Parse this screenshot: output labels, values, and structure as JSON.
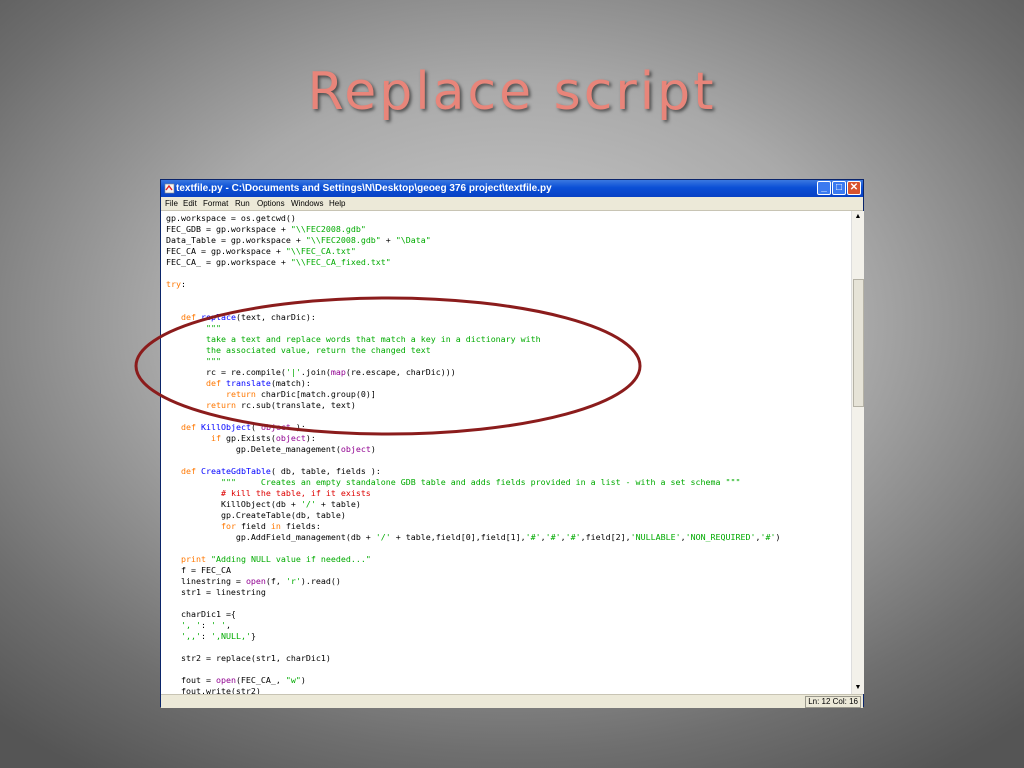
{
  "slide": {
    "title": "Replace script"
  },
  "window": {
    "title": "textfile.py - C:\\Documents and Settings\\N\\Desktop\\geoeg 376 project\\textfile.py",
    "controls": {
      "minimize": "_",
      "maximize": "□",
      "close": "✕"
    }
  },
  "menu": [
    "File",
    "Edit",
    "Format",
    "Run",
    "Options",
    "Windows",
    "Help"
  ],
  "code_lines": [
    [
      [
        "n",
        "gp.workspace = os.getcwd()"
      ]
    ],
    [
      [
        "n",
        "FEC_GDB = gp.workspace + "
      ],
      [
        "s",
        "\"\\\\FEC2008.gdb\""
      ]
    ],
    [
      [
        "n",
        "Data_Table = gp.workspace + "
      ],
      [
        "s",
        "\"\\\\FEC2008.gdb\""
      ],
      [
        "n",
        " + "
      ],
      [
        "s",
        "\"\\Data\""
      ]
    ],
    [
      [
        "n",
        "FEC_CA = gp.workspace + "
      ],
      [
        "s",
        "\"\\\\FEC_CA.txt\""
      ]
    ],
    [
      [
        "n",
        "FEC_CA_ = gp.workspace + "
      ],
      [
        "s",
        "\"\\\\FEC_CA_fixed.txt\""
      ]
    ],
    [
      [
        "n",
        ""
      ]
    ],
    [
      [
        "k",
        "try"
      ],
      [
        "n",
        ":"
      ]
    ],
    [
      [
        "n",
        ""
      ]
    ],
    [
      [
        "n",
        ""
      ]
    ],
    [
      [
        "n",
        "   "
      ],
      [
        "k",
        "def"
      ],
      [
        "n",
        " "
      ],
      [
        "f",
        "replace"
      ],
      [
        "n",
        "(text, charDic):"
      ]
    ],
    [
      [
        "n",
        "        "
      ],
      [
        "s",
        "\"\"\""
      ]
    ],
    [
      [
        "n",
        "        "
      ],
      [
        "s",
        "take a text and replace words that match a key in a dictionary with"
      ]
    ],
    [
      [
        "n",
        "        "
      ],
      [
        "s",
        "the associated value, return the changed text"
      ]
    ],
    [
      [
        "n",
        "        "
      ],
      [
        "s",
        "\"\"\""
      ]
    ],
    [
      [
        "n",
        "        rc = re.compile("
      ],
      [
        "s",
        "'|'"
      ],
      [
        "n",
        ".join("
      ],
      [
        "b",
        "map"
      ],
      [
        "n",
        "(re.escape, charDic)))"
      ]
    ],
    [
      [
        "n",
        "        "
      ],
      [
        "k",
        "def"
      ],
      [
        "n",
        " "
      ],
      [
        "f",
        "translate"
      ],
      [
        "n",
        "(match):"
      ]
    ],
    [
      [
        "n",
        "            "
      ],
      [
        "k",
        "return"
      ],
      [
        "n",
        " charDic[match.group(0)]"
      ]
    ],
    [
      [
        "n",
        "        "
      ],
      [
        "k",
        "return"
      ],
      [
        "n",
        " rc.sub(translate, text)"
      ]
    ],
    [
      [
        "n",
        ""
      ]
    ],
    [
      [
        "n",
        "   "
      ],
      [
        "k",
        "def"
      ],
      [
        "n",
        " "
      ],
      [
        "f",
        "KillObject"
      ],
      [
        "n",
        "( "
      ],
      [
        "b",
        "object"
      ],
      [
        "n",
        " ):"
      ]
    ],
    [
      [
        "n",
        "         "
      ],
      [
        "k",
        "if"
      ],
      [
        "n",
        " gp.Exists("
      ],
      [
        "b",
        "object"
      ],
      [
        "n",
        "):"
      ]
    ],
    [
      [
        "n",
        "              gp.Delete_management("
      ],
      [
        "b",
        "object"
      ],
      [
        "n",
        ")"
      ]
    ],
    [
      [
        "n",
        ""
      ]
    ],
    [
      [
        "n",
        "   "
      ],
      [
        "k",
        "def"
      ],
      [
        "n",
        " "
      ],
      [
        "f",
        "CreateGdbTable"
      ],
      [
        "n",
        "( db, table, fields ):"
      ]
    ],
    [
      [
        "n",
        "           "
      ],
      [
        "s",
        "\"\"\"     Creates an empty standalone GDB table and adds fields provided in a list - with a set schema \"\"\""
      ]
    ],
    [
      [
        "n",
        "           "
      ],
      [
        "c",
        "# kill the table, if it exists"
      ]
    ],
    [
      [
        "n",
        "           KillObject(db + "
      ],
      [
        "s",
        "'/'"
      ],
      [
        "n",
        " + table)"
      ]
    ],
    [
      [
        "n",
        "           gp.CreateTable(db, table)"
      ]
    ],
    [
      [
        "n",
        "           "
      ],
      [
        "k",
        "for"
      ],
      [
        "n",
        " field "
      ],
      [
        "k",
        "in"
      ],
      [
        "n",
        " fields:"
      ]
    ],
    [
      [
        "n",
        "              gp.AddField_management(db + "
      ],
      [
        "s",
        "'/'"
      ],
      [
        "n",
        " + table,field[0],field[1],"
      ],
      [
        "s",
        "'#'"
      ],
      [
        "n",
        ","
      ],
      [
        "s",
        "'#'"
      ],
      [
        "n",
        ","
      ],
      [
        "s",
        "'#'"
      ],
      [
        "n",
        ",field[2],"
      ],
      [
        "s",
        "'NULLABLE'"
      ],
      [
        "n",
        ","
      ],
      [
        "s",
        "'NON_REQUIRED'"
      ],
      [
        "n",
        ","
      ],
      [
        "s",
        "'#'"
      ],
      [
        "n",
        ")"
      ]
    ],
    [
      [
        "n",
        ""
      ]
    ],
    [
      [
        "n",
        "   "
      ],
      [
        "k",
        "print"
      ],
      [
        "n",
        " "
      ],
      [
        "s",
        "\"Adding NULL value if needed...\""
      ]
    ],
    [
      [
        "n",
        "   f = FEC_CA"
      ]
    ],
    [
      [
        "n",
        "   linestring = "
      ],
      [
        "b",
        "open"
      ],
      [
        "n",
        "(f, "
      ],
      [
        "s",
        "'r'"
      ],
      [
        "n",
        ").read()"
      ]
    ],
    [
      [
        "n",
        "   str1 = linestring"
      ]
    ],
    [
      [
        "n",
        ""
      ]
    ],
    [
      [
        "n",
        "   charDic1 ={"
      ]
    ],
    [
      [
        "n",
        "   "
      ],
      [
        "s",
        "', '"
      ],
      [
        "n",
        ": "
      ],
      [
        "s",
        "' '"
      ],
      [
        "n",
        ","
      ]
    ],
    [
      [
        "n",
        "   "
      ],
      [
        "s",
        "',,'"
      ],
      [
        "n",
        ": "
      ],
      [
        "s",
        "',NULL,'"
      ],
      [
        "n",
        "}"
      ]
    ],
    [
      [
        "n",
        ""
      ]
    ],
    [
      [
        "n",
        "   str2 = replace(str1, charDic1)"
      ]
    ],
    [
      [
        "n",
        ""
      ]
    ],
    [
      [
        "n",
        "   fout = "
      ],
      [
        "b",
        "open"
      ],
      [
        "n",
        "(FEC_CA_, "
      ],
      [
        "s",
        "\"w\""
      ],
      [
        "n",
        ")"
      ]
    ],
    [
      [
        "n",
        "   fout.write(str2)"
      ]
    ]
  ],
  "status": {
    "position": "Ln: 12 Col: 16"
  },
  "scroll": {
    "up": "▲",
    "down": "▼"
  },
  "colors": {
    "keyword": "#ff7700",
    "builtin": "#900090",
    "string": "#00aa00",
    "comment": "#dd0000",
    "definition": "#0000ff",
    "annotation": "#8b1c1c"
  }
}
